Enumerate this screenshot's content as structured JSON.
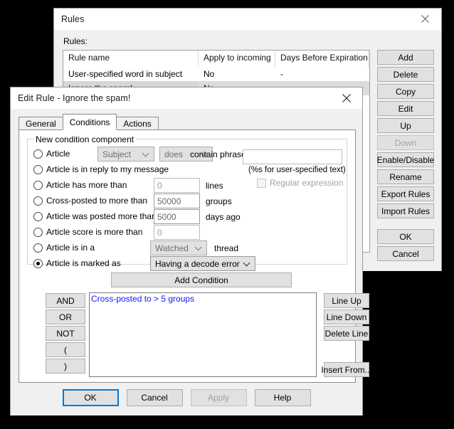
{
  "rules_window": {
    "title": "Rules",
    "close_icon": "close-icon",
    "list_label": "Rules:",
    "table": {
      "columns": [
        "Rule name",
        "Apply to incoming",
        "Days Before Expiration"
      ],
      "rows": [
        {
          "name": "User-specified word in subject",
          "apply": "No",
          "days": "-",
          "selected": false
        },
        {
          "name": "Ignore the spam!",
          "apply": "No",
          "days": "-",
          "selected": true
        }
      ]
    },
    "buttons": [
      {
        "label": "Add",
        "disabled": false
      },
      {
        "label": "Delete",
        "disabled": false
      },
      {
        "label": "Copy",
        "disabled": false
      },
      {
        "label": "Edit",
        "disabled": false
      },
      {
        "label": "Up",
        "disabled": false
      },
      {
        "label": "Down",
        "disabled": true
      },
      {
        "label": "Enable/Disable",
        "disabled": false
      },
      {
        "label": "Rename",
        "disabled": false
      },
      {
        "label": "Export Rules",
        "disabled": false
      },
      {
        "label": "Import Rules",
        "disabled": false
      }
    ],
    "footer_buttons": [
      {
        "label": "OK",
        "disabled": false
      },
      {
        "label": "Cancel",
        "disabled": false
      }
    ]
  },
  "edit_window": {
    "title": "Edit Rule - Ignore the spam!",
    "close_icon": "close-icon",
    "tabs": [
      {
        "label": "General",
        "active": false
      },
      {
        "label": "Conditions",
        "active": true
      },
      {
        "label": "Actions",
        "active": false
      }
    ],
    "group": {
      "legend": "New condition component",
      "rows": [
        {
          "label": "Article",
          "selected": false
        },
        {
          "label": "Article is in reply to my message",
          "selected": false
        },
        {
          "label": "Article has more than",
          "selected": false
        },
        {
          "label": "Cross-posted to more than",
          "selected": false
        },
        {
          "label": "Article was posted more than",
          "selected": false
        },
        {
          "label": "Article score is more than",
          "selected": false
        },
        {
          "label": "Article is in a",
          "selected": false
        },
        {
          "label": "Article is marked as",
          "selected": true
        }
      ],
      "field_combo": {
        "value": "Subject",
        "disabled": true
      },
      "match_combo": {
        "value": "does",
        "disabled": true
      },
      "contain_label": "contain phrase",
      "phrase_value": "",
      "phrase_hint": "(%s for user-specified text)",
      "regex_checkbox": {
        "label": "Regular expression",
        "checked": false,
        "disabled": true
      },
      "lines_value": "0",
      "lines_unit": "lines",
      "groups_value": "50000",
      "groups_unit": "groups",
      "days_value": "5000",
      "days_unit": "days ago",
      "score_value": "0",
      "thread_combo": {
        "value": "Watched",
        "disabled": true
      },
      "thread_unit": "thread",
      "marked_combo": {
        "value": "Having a decode error",
        "disabled": false
      }
    },
    "add_condition_label": "Add Condition",
    "operator_buttons": [
      "AND",
      "OR",
      "NOT",
      "(",
      ")"
    ],
    "condition_list": [
      "Cross-posted to > 5 groups"
    ],
    "list_buttons_top": [
      "Line Up",
      "Line Down",
      "Delete Line"
    ],
    "list_buttons_bottom": [
      "Insert From..."
    ],
    "footer_buttons": [
      {
        "label": "OK",
        "disabled": false,
        "default": true
      },
      {
        "label": "Cancel",
        "disabled": false,
        "default": false
      },
      {
        "label": "Apply",
        "disabled": true,
        "default": false
      },
      {
        "label": "Help",
        "disabled": false,
        "default": false
      }
    ]
  },
  "colors": {
    "dialog_face": "#f0f0f0",
    "button_face": "#e1e1e1",
    "accent_focus": "#0078d7",
    "condition_text": "#1414ff",
    "disabled_text": "#a0a0a0",
    "selection_row": "#dcdcdc"
  }
}
